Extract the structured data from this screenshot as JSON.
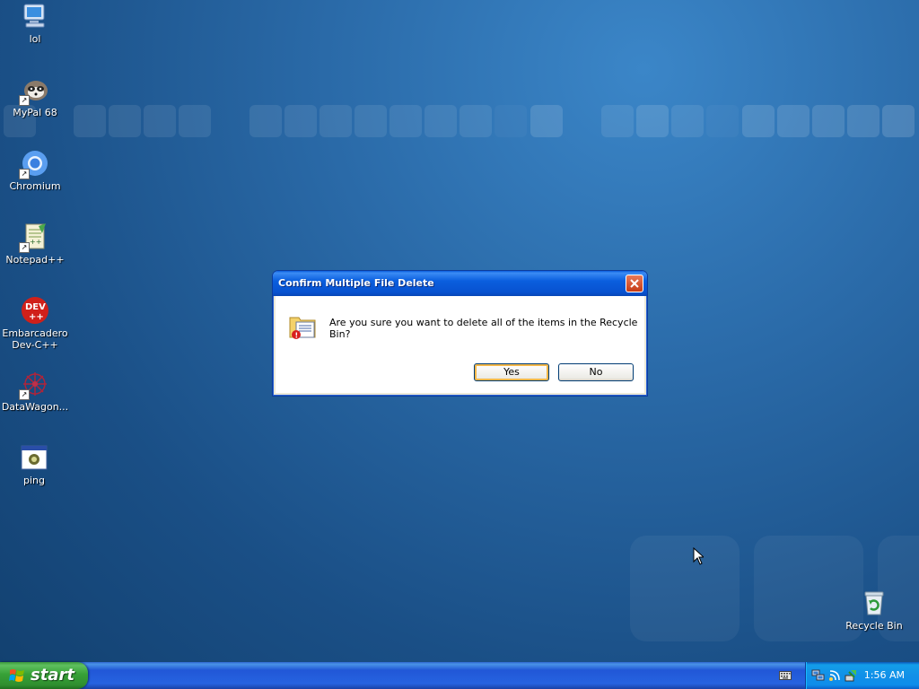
{
  "desktop": {
    "icons": [
      {
        "label": "lol",
        "icon": "computer-icon"
      },
      {
        "label": "MyPal 68",
        "icon": "raccoon-icon"
      },
      {
        "label": "Chromium",
        "icon": "chromium-icon"
      },
      {
        "label": "Notepad++",
        "icon": "notepad-plus-plus-icon"
      },
      {
        "label": "Embarcadero Dev-C++",
        "icon": "dev-cpp-icon"
      },
      {
        "label": "DataWagon...",
        "icon": "datawagon-icon"
      },
      {
        "label": "ping",
        "icon": "ping-app-icon"
      }
    ],
    "recycle_bin": {
      "label": "Recycle Bin",
      "icon": "recycle-bin-icon"
    }
  },
  "dialog": {
    "title": "Confirm Multiple File Delete",
    "message": "Are you sure you want to delete all of the items in the Recycle Bin?",
    "yes_label": "Yes",
    "no_label": "No",
    "icon": "delete-files-warning-icon"
  },
  "taskbar": {
    "start_label": "start",
    "clock": "1:56 AM"
  },
  "colors": {
    "desktop": "#1f5a96",
    "titlebar": "#0a5ede",
    "taskbar": "#2157d7",
    "start": "#37a137"
  }
}
